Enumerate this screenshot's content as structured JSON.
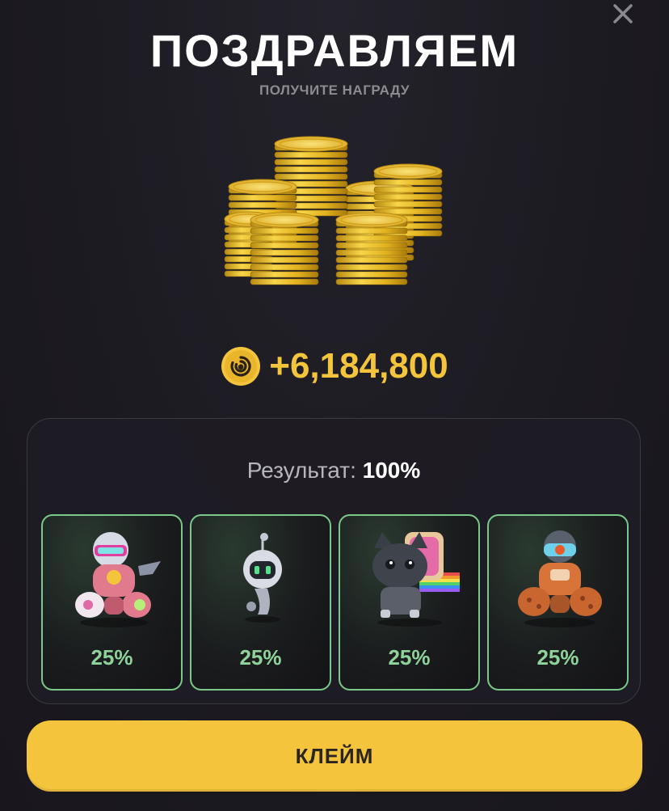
{
  "header": {
    "title": "ПОЗДРАВЛЯЕМ",
    "subtitle": "ПОЛУЧИТЕ НАГРАДУ",
    "close_icon": "close-icon"
  },
  "reward": {
    "amount": "+6,184,800",
    "icon": "coin-token-icon",
    "image": "coin-stacks-icon"
  },
  "result": {
    "label": "Результат: ",
    "value": "100%",
    "cards": [
      {
        "percent": "25%",
        "icon": "robot-pink-icon"
      },
      {
        "percent": "25%",
        "icon": "robot-small-icon"
      },
      {
        "percent": "25%",
        "icon": "cat-toast-icon"
      },
      {
        "percent": "25%",
        "icon": "robot-orange-icon"
      }
    ]
  },
  "claim": {
    "label": "КЛЕЙМ"
  },
  "colors": {
    "background": "#1c1a21",
    "accent_gold": "#f4c53c",
    "card_border": "#7ac98a",
    "percent_text": "#8fd29a",
    "muted_text": "#8d8b92"
  }
}
